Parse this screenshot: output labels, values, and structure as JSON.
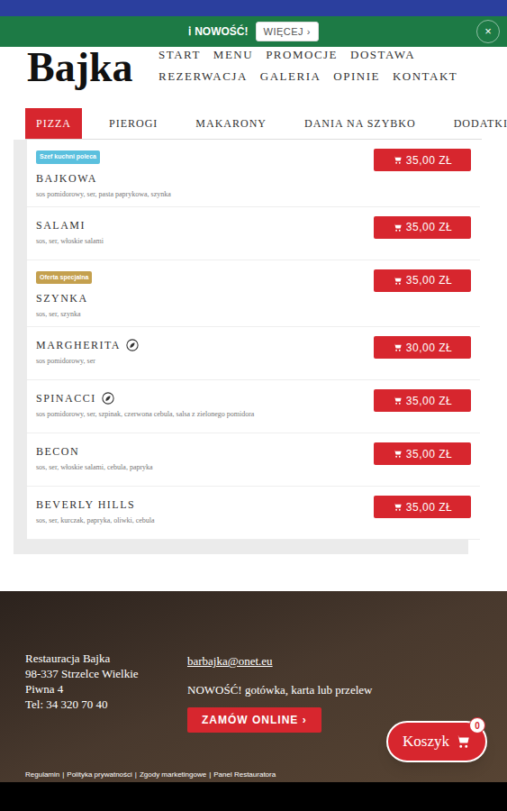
{
  "top_notice": {
    "icon": "ℹ",
    "label": "NOWOŚĆ!",
    "button": "WIĘCEJ ›",
    "close": "×"
  },
  "header": {
    "logo": "Bajka",
    "nav_rows": [
      [
        "START",
        "MENU",
        "PROMOCJE",
        "DOSTAWA"
      ],
      [
        "REZERWACJA",
        "GALERIA",
        "OPINIE",
        "KONTAKT"
      ]
    ]
  },
  "tabs": [
    {
      "label": "PIZZA",
      "selected": true
    },
    {
      "label": "PIEROGI",
      "selected": false
    },
    {
      "label": "MAKARONY",
      "selected": false
    },
    {
      "label": "DANIA NA SZYBKO",
      "selected": false
    },
    {
      "label": "DODATKI",
      "selected": false
    }
  ],
  "items": [
    {
      "name": "BAJKOWA",
      "description": "sos pomidorowy, ser, pasta paprykowa, szynka",
      "price": "35,00 ZŁ",
      "vegetarian": false,
      "badge": {
        "label": "Szef kuchni poleca",
        "color": "#5bc0de"
      }
    },
    {
      "name": "SALAMI",
      "description": "sos, ser, włoskie salami",
      "price": "35,00 ZŁ",
      "vegetarian": false
    },
    {
      "name": "SZYNKA",
      "description": "sos, ser, szynka",
      "price": "35,00 ZŁ",
      "vegetarian": false,
      "badge": {
        "label": "Oferta specjalna",
        "color": "#c4a04e"
      }
    },
    {
      "name": "MARGHERITA",
      "description": "sos pomidorowy, ser",
      "price": "30,00 ZŁ",
      "vegetarian": true
    },
    {
      "name": "SPINACCI",
      "description": "sos pomidorowy, ser, szpinak, czerwona cebula, salsa z zielonego pomidora",
      "price": "35,00 ZŁ",
      "vegetarian": true
    },
    {
      "name": "BECON",
      "description": "sos, ser, włoskie salami, cebula, papryka",
      "price": "35,00 ZŁ",
      "vegetarian": false
    },
    {
      "name": "BEVERLY HILLS",
      "description": "sos, ser, kurczak, papryka, oliwki, cebula",
      "price": "35,00 ZŁ",
      "vegetarian": false
    }
  ],
  "footer": {
    "address": [
      "Restauracja Bajka",
      "98-337 Strzelce Wielkie",
      "Piwna 4",
      "Tel: 34 320 70 40"
    ],
    "email": "barbajka@onet.eu",
    "note": "NOWOŚĆ! gotówka, karta lub przelew",
    "order_button": "ZAMÓW ONLINE ›",
    "links": [
      "Regulamin",
      "Polityka prywatności",
      "Zgody marketingowe",
      "Panel Restauratora"
    ],
    "separator": "|"
  },
  "cart": {
    "label": "Koszyk",
    "count": "0"
  }
}
